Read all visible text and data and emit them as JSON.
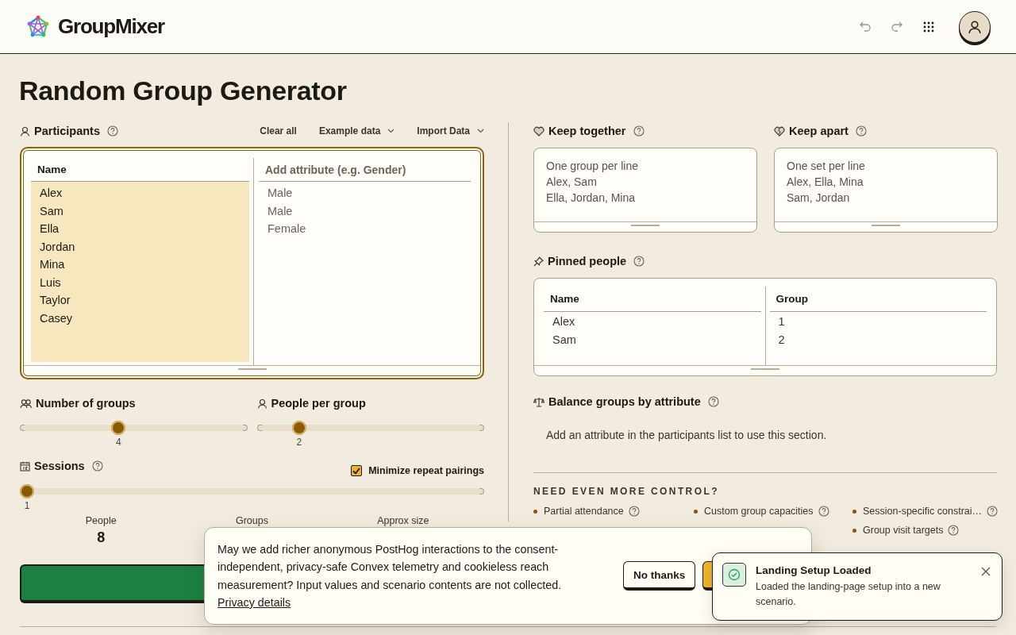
{
  "header": {
    "brand": "GroupMixer",
    "actions": [
      {
        "kind": "undo",
        "disabled": true
      },
      {
        "kind": "redo",
        "disabled": true
      },
      {
        "kind": "apps",
        "disabled": false
      },
      {
        "kind": "account",
        "disabled": false
      }
    ]
  },
  "title": "Random Group Generator",
  "participants": {
    "label": "Participants",
    "actions": [
      {
        "label": "Clear all",
        "dropdown": false
      },
      {
        "label": "Example data",
        "dropdown": true
      },
      {
        "label": "Import Data",
        "dropdown": true
      }
    ],
    "name_header": "Name",
    "attribute_placeholder": "Add attribute (e.g. Gender)",
    "names": [
      "Alex",
      "Sam",
      "Ella",
      "Jordan",
      "Mina",
      "Luis",
      "Taylor",
      "Casey"
    ],
    "attribute_values": [
      "Male",
      "Male",
      "Female"
    ]
  },
  "sliders": [
    {
      "label": "Number of groups",
      "level": 0.43,
      "reading": "4"
    },
    {
      "label": "People per group",
      "level": 0.165,
      "reading": "2"
    }
  ],
  "sessions": {
    "label": "Sessions",
    "level": 0,
    "reading": "1",
    "option": {
      "label": "Minimize repeat pairings",
      "checked": true
    }
  },
  "stats": [
    {
      "label": "People",
      "value": "8"
    },
    {
      "label": "Groups"
    },
    {
      "label": "Approx size"
    }
  ],
  "keep_together": {
    "label": "Keep together",
    "lines": [
      "One group per line",
      "Alex, Sam",
      "Ella, Jordan, Mina"
    ]
  },
  "keep_apart": {
    "label": "Keep apart",
    "lines": [
      "One set per line",
      "Alex, Ella, Mina",
      "Sam, Jordan"
    ]
  },
  "pinned": {
    "label": "Pinned people",
    "columns": [
      "Name",
      "Group"
    ],
    "rows": [
      [
        "Alex",
        "1"
      ],
      [
        "Sam",
        "2"
      ]
    ]
  },
  "balance": {
    "label": "Balance groups by attribute",
    "message": "Add an attribute in the participants list to use this section."
  },
  "more": {
    "heading": "NEED EVEN MORE CONTROL?",
    "columns": [
      [
        "Partial attendance"
      ],
      [
        "Custom group capacities"
      ],
      [
        "Session-specific constrai…",
        "Group visit targets"
      ]
    ]
  },
  "consent": {
    "text": "May we add richer anonymous PostHog interactions to the consent-independent, privacy-safe Convex telemetry and cookieless reach measurement? Input values and scenario contents are not collected.",
    "link": "Privacy details",
    "decline": "No thanks"
  },
  "toast": {
    "title": "Landing Setup Loaded",
    "message": "Loaded the landing-page setup into a new scenario."
  }
}
